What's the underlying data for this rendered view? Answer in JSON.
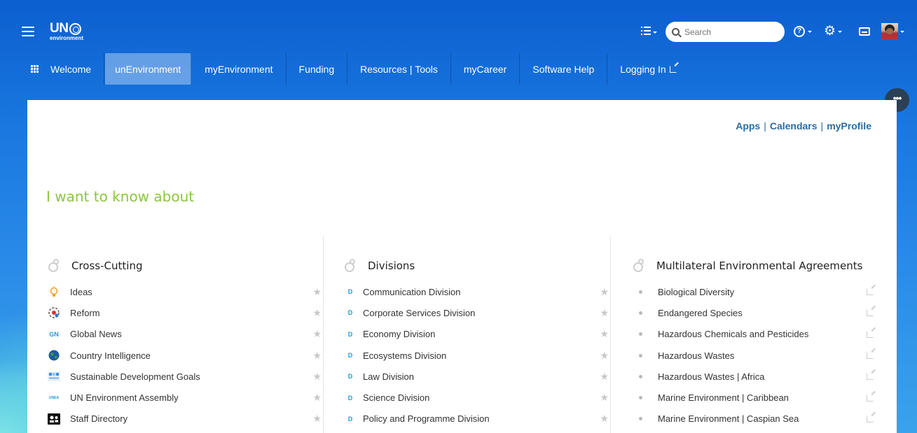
{
  "header": {
    "logo_un": "UN",
    "logo_sub": "environment",
    "search_placeholder": "Search"
  },
  "nav": {
    "items": [
      {
        "label": "Welcome"
      },
      {
        "label": "unEnvironment"
      },
      {
        "label": "myEnvironment"
      },
      {
        "label": "Funding"
      },
      {
        "label": "Resources | Tools"
      },
      {
        "label": "myCareer"
      },
      {
        "label": "Software Help"
      },
      {
        "label": "Logging In"
      }
    ]
  },
  "more_label": "•••",
  "toplinks": {
    "apps": "Apps",
    "calendars": "Calendars",
    "profile": "myProfile",
    "sep": "|"
  },
  "heading": "I want to know about",
  "columns": {
    "cross": {
      "title": "Cross-Cutting",
      "items": [
        {
          "label": "Ideas",
          "icon": "lightbulb-icon"
        },
        {
          "label": "Reform",
          "icon": "reform-icon"
        },
        {
          "label": "Global News",
          "icon": "gn-icon",
          "badge": "GN"
        },
        {
          "label": "Country Intelligence",
          "icon": "globe-icon"
        },
        {
          "label": "Sustainable Development Goals",
          "icon": "sdg-icon"
        },
        {
          "label": "UN Environment Assembly",
          "icon": "unea-icon",
          "badge": "UNEA"
        },
        {
          "label": "Staff Directory",
          "icon": "directory-icon"
        }
      ]
    },
    "divisions": {
      "title": "Divisions",
      "badge": "D",
      "items": [
        {
          "label": "Communication Division"
        },
        {
          "label": "Corporate Services Division"
        },
        {
          "label": "Economy Division"
        },
        {
          "label": "Ecosystems Division"
        },
        {
          "label": "Law Division"
        },
        {
          "label": "Science Division"
        },
        {
          "label": "Policy and Programme Division"
        }
      ]
    },
    "mea": {
      "title": "Multilateral Environmental Agreements",
      "items": [
        {
          "label": "Biological Diversity"
        },
        {
          "label": "Endangered Species"
        },
        {
          "label": "Hazardous Chemicals and Pesticides"
        },
        {
          "label": "Hazardous Wastes"
        },
        {
          "label": "Hazardous Wastes | Africa"
        },
        {
          "label": "Marine Environment | Caribbean"
        },
        {
          "label": "Marine Environment | Caspian Sea"
        }
      ]
    }
  },
  "colors": {
    "heading": "#8cc63e",
    "link": "#2b6ca3",
    "division_badge": "#1a9bd7"
  }
}
